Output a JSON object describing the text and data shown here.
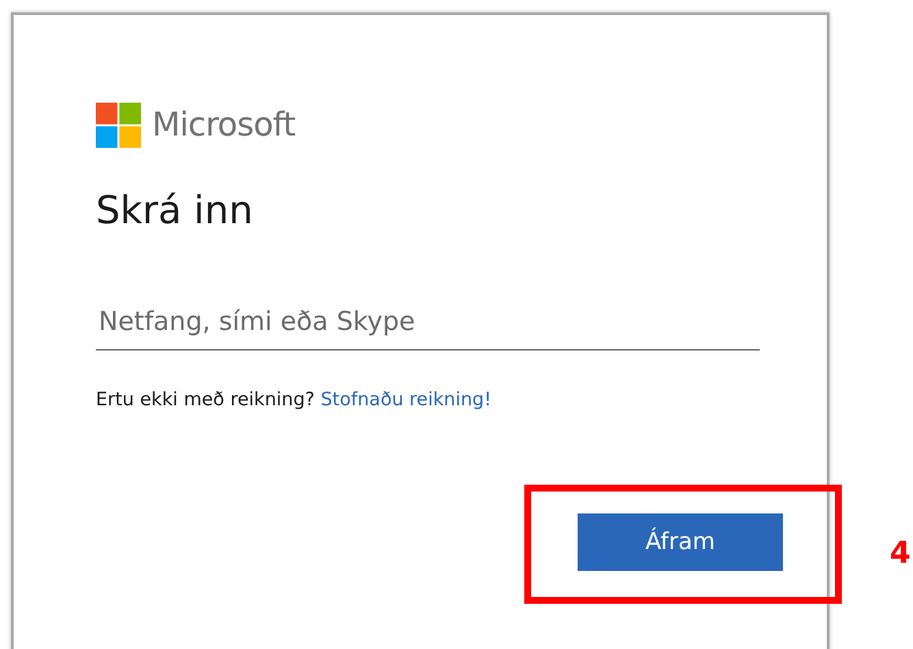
{
  "brand": {
    "name": "Microsoft"
  },
  "title": "Skrá inn",
  "login_field": {
    "placeholder": "Netfang, sími eða Skype"
  },
  "signup": {
    "prompt": "Ertu ekki með reikning?",
    "link": "Stofnaðu reikning!"
  },
  "next_button": {
    "label": "Áfram",
    "highlighted": true
  },
  "step_marker": "4"
}
